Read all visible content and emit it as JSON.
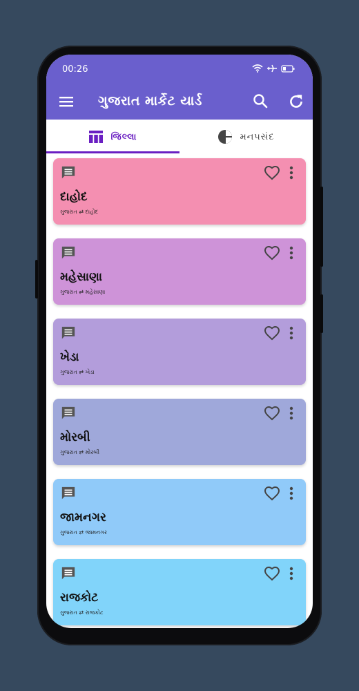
{
  "status": {
    "time": "00:26"
  },
  "appbar": {
    "title": "ગુજરાત માર્કેટ યાર્ડ"
  },
  "tabs": [
    {
      "label": "જિલ્લા",
      "icon": "table-icon",
      "active": true
    },
    {
      "label": "મનપસંદ",
      "icon": "pie-chart-icon",
      "active": false
    }
  ],
  "districts": [
    {
      "name": "દાહોદ",
      "path": "ગુજરાત ⇄ દાહોદ",
      "color": "#f48fb1"
    },
    {
      "name": "મહેસાણા",
      "path": "ગુજરાત ⇄ મહેસાણા",
      "color": "#ce93d8"
    },
    {
      "name": "ખેડા",
      "path": "ગુજરાત ⇄ ખેડા",
      "color": "#b39ddb"
    },
    {
      "name": "મોરબી",
      "path": "ગુજરાત ⇄ મોરબી",
      "color": "#9fa8da"
    },
    {
      "name": "જામનગર",
      "path": "ગુજરાત ⇄ જામનગર",
      "color": "#90caf9"
    },
    {
      "name": "રાજકોટ",
      "path": "ગુજરાત ⇄ રાજકોટ",
      "color": "#81d4fa"
    }
  ]
}
